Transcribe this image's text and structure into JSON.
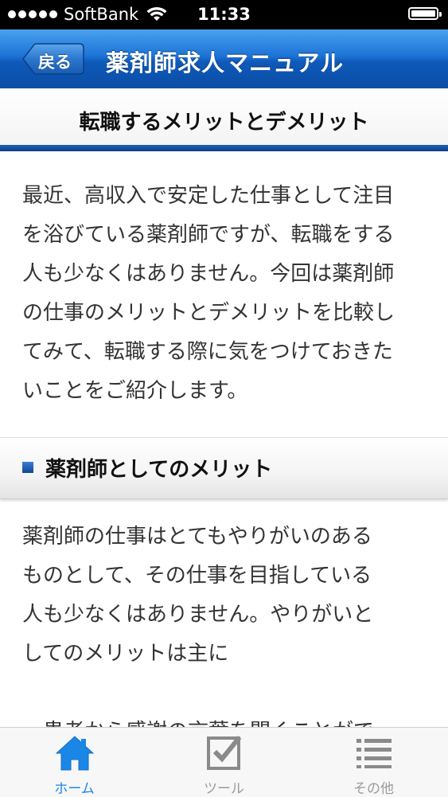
{
  "status_bar": {
    "carrier": "SoftBank",
    "time": "11:33",
    "icons": [
      "signal-dots-icon",
      "wifi-icon",
      "battery-icon"
    ]
  },
  "nav": {
    "back_label": "戻る",
    "title": "薬剤師求人マニュアル"
  },
  "section": {
    "title": "転職するメリットとデメリット"
  },
  "content": {
    "intro_lines": [
      "最近、高収入で安定した仕事として注目",
      "を浴びている薬剤師ですが、転職をする",
      "人も少なくはありません。今回は薬剤師",
      "の仕事のメリットとデメリットを比較し",
      "てみて、転職する際に気をつけておきた",
      "いことをご紹介します。"
    ],
    "subheader": "薬剤師としてのメリット",
    "merit_lines": [
      "薬剤師の仕事はとてもやりがいのある",
      "ものとして、その仕事を目指している",
      "人も少なくはありません。やりがいと",
      "してのメリットは主に"
    ],
    "partial_line": "・患者から感謝の言葉を聞くことがで"
  },
  "tabs": [
    {
      "label": "ホーム",
      "icon": "home-icon",
      "active": true
    },
    {
      "label": "ツール",
      "icon": "checkbox-icon",
      "active": false
    },
    {
      "label": "その他",
      "icon": "list-icon",
      "active": false
    }
  ],
  "colors": {
    "nav_blue": "#1d73d6",
    "tab_active": "#1a86e6",
    "tab_inactive": "#9a9a9a"
  }
}
